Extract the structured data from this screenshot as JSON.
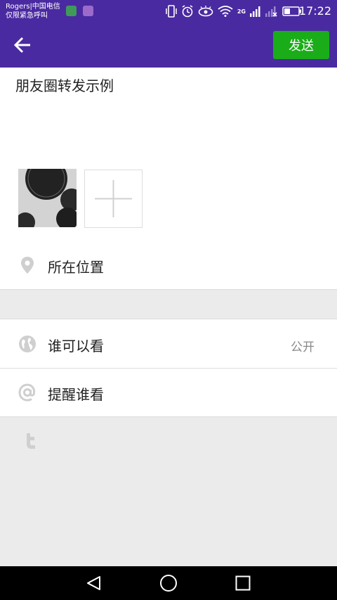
{
  "status_bar": {
    "carrier_line1": "Rogers|中国电信",
    "carrier_line2": "仅限紧急呼叫",
    "network": "2G",
    "time": "17:22"
  },
  "app_bar": {
    "send_label": "发送"
  },
  "post": {
    "text": "朋友圈转发示例"
  },
  "location": {
    "label": "所在位置"
  },
  "visibility": {
    "label": "谁可以看",
    "value": "公开"
  },
  "mention": {
    "label": "提醒谁看"
  },
  "colors": {
    "primary": "#4a2aa0",
    "send_button": "#1aad19",
    "icon_gray": "#cfcfcf",
    "background_gray": "#ebebeb"
  }
}
